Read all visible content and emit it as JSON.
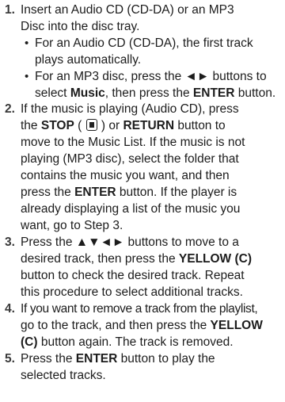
{
  "steps": [
    {
      "number": "1.",
      "lines": [
        "Insert an Audio CD (CD-DA) or an MP3",
        "Disc into the disc tray."
      ],
      "bullets": [
        {
          "lines": [
            "For an Audio CD (CD-DA), the first track",
            "plays automatically."
          ]
        },
        {
          "lines": [
            "For an MP3 disc, press the ◄► buttons to",
            "select Music, then press the ENTER button."
          ]
        }
      ]
    },
    {
      "number": "2.",
      "lines": [
        "If the music is playing (Audio CD), press",
        "the STOP ( ■ ) or RETURN button to",
        "move to the Music List. If the music is not",
        "playing (MP3 disc), select the folder that",
        "contains the music you want, and then",
        "press the ENTER button. If the player is",
        "already displaying a list of the music you",
        "want, go to Step 3."
      ]
    },
    {
      "number": "3.",
      "lines": [
        "Press the ▲▼◄► buttons to move to a",
        "desired track, then press the YELLOW (C)",
        "button to check the desired track. Repeat",
        "this procedure to select additional tracks."
      ]
    },
    {
      "number": "4.",
      "lines": [
        "If you want to remove a track from the playlist,",
        "go to the track, and then press the YELLOW",
        "(C) button again. The track is removed."
      ]
    },
    {
      "number": "5.",
      "lines": [
        "Press the ENTER button to play the",
        "selected tracks."
      ]
    }
  ]
}
